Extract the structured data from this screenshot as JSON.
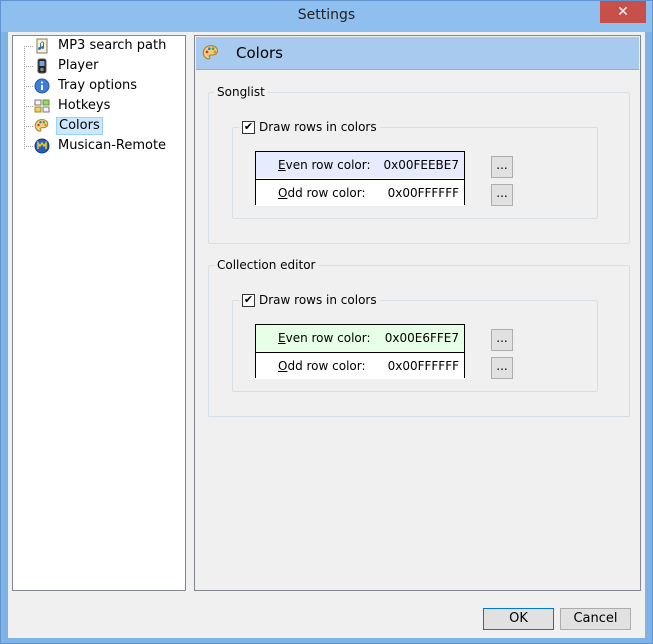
{
  "window": {
    "title": "Settings",
    "close_glyph": "✕"
  },
  "tree": {
    "items": [
      {
        "label": "MP3 search path",
        "icon": "music-file-icon"
      },
      {
        "label": "Player",
        "icon": "player-device-icon"
      },
      {
        "label": "Tray options",
        "icon": "info-icon"
      },
      {
        "label": "Hotkeys",
        "icon": "hotkeys-icon"
      },
      {
        "label": "Colors",
        "icon": "palette-icon",
        "selected": true
      },
      {
        "label": "Musican-Remote",
        "icon": "remote-icon"
      }
    ]
  },
  "panel": {
    "title": "Colors",
    "songlist": {
      "title": "Songlist",
      "checkbox_label": "Draw rows in colors",
      "checked": true,
      "even_label_prefix": "E",
      "even_label_rest": "ven row color:",
      "even_value": "0x00FEEBE7",
      "even_color": "#e7ebfe",
      "odd_label_prefix": "O",
      "odd_label_rest": "dd row color:",
      "odd_value": "0x00FFFFFF",
      "odd_color": "#ffffff",
      "button_label": "..."
    },
    "collection": {
      "title": "Collection editor",
      "checkbox_label": "Draw rows in colors",
      "checked": true,
      "even_label_prefix": "E",
      "even_label_rest": "ven row color:",
      "even_value": "0x00E6FFE7",
      "even_color": "#e7ffe6",
      "odd_label_prefix": "O",
      "odd_label_rest": "dd row color:",
      "odd_value": "0x00FFFFFF",
      "odd_color": "#ffffff",
      "button_label": "..."
    }
  },
  "footer": {
    "ok_label": "OK",
    "cancel_label": "Cancel"
  }
}
